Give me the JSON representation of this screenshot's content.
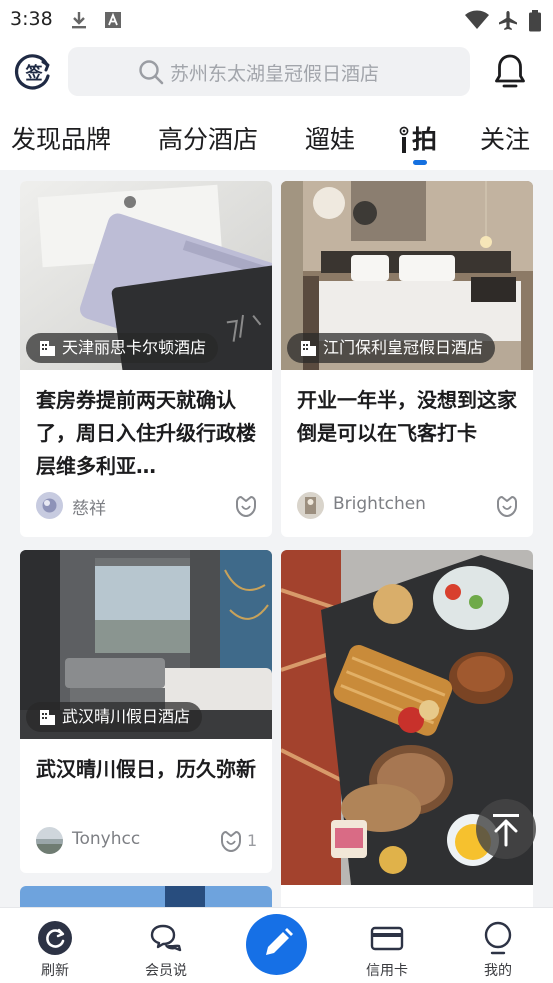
{
  "status_bar": {
    "time": "3:38"
  },
  "header": {
    "sign_icon_label": "签",
    "search_placeholder": "苏州东太湖皇冠假日酒店"
  },
  "tabs": [
    {
      "label": "发现品牌"
    },
    {
      "label": "高分酒店"
    },
    {
      "label": "遛娃"
    },
    {
      "label": "拍"
    },
    {
      "label": "关注"
    }
  ],
  "active_tab": "拍",
  "feed": {
    "cards": [
      {
        "location": "天津丽思卡尔顿酒店",
        "title": "套房券提前两天就确认了，周日入住升级行政楼层维多利亚…",
        "author": "慈祥",
        "likes": ""
      },
      {
        "location": "江门保利皇冠假日酒店",
        "title": "开业一年半，没想到这家倒是可以在飞客打卡",
        "author": "Brightchen",
        "likes": ""
      },
      {
        "location": "武汉晴川假日酒店",
        "title": "武汉晴川假日，历久弥新",
        "author": "Tonyhcc",
        "likes": "1"
      }
    ]
  },
  "bottom_nav": [
    {
      "label": "刷新",
      "icon": "refresh-icon"
    },
    {
      "label": "会员说",
      "icon": "chat-bubbles-icon"
    },
    {
      "label": "",
      "icon": "pencil-icon"
    },
    {
      "label": "信用卡",
      "icon": "credit-card-icon"
    },
    {
      "label": "我的",
      "icon": "profile-icon"
    }
  ],
  "colors": {
    "accent": "#1670e6",
    "tab_indicator": "#1470e0",
    "text": "#1c1c1e",
    "muted": "#7d7f84"
  }
}
